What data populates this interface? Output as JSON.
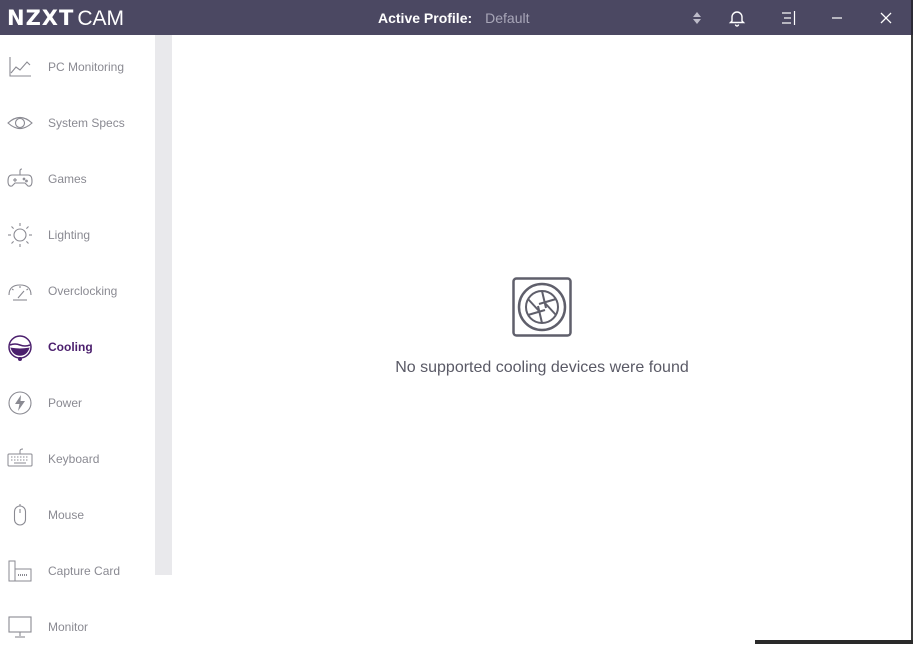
{
  "app": {
    "brand": "NZXT",
    "product": "CAM"
  },
  "header": {
    "profile_label": "Active Profile:",
    "profile_value": "Default",
    "icons": [
      "sort-updown-icon",
      "bell-icon",
      "menu-icon",
      "minimize-icon",
      "close-icon"
    ]
  },
  "sidebar": {
    "items": [
      {
        "label": "PC Monitoring",
        "icon": "line-chart-icon",
        "active": false
      },
      {
        "label": "System Specs",
        "icon": "eye-icon",
        "active": false
      },
      {
        "label": "Games",
        "icon": "gamepad-icon",
        "active": false
      },
      {
        "label": "Lighting",
        "icon": "sun-icon",
        "active": false
      },
      {
        "label": "Overclocking",
        "icon": "gauge-icon",
        "active": false
      },
      {
        "label": "Cooling",
        "icon": "cooling-icon",
        "active": true
      },
      {
        "label": "Power",
        "icon": "lightning-icon",
        "active": false
      },
      {
        "label": "Keyboard",
        "icon": "keyboard-icon",
        "active": false
      },
      {
        "label": "Mouse",
        "icon": "mouse-icon",
        "active": false
      },
      {
        "label": "Capture Card",
        "icon": "capture-card-icon",
        "active": false
      },
      {
        "label": "Monitor",
        "icon": "monitor-icon",
        "active": false
      }
    ]
  },
  "main": {
    "empty_message": "No supported cooling devices were found",
    "empty_icon": "fan-icon"
  },
  "colors": {
    "titlebar": "#4b4862",
    "active": "#4b1f6d",
    "inactive_text": "#8a8a92",
    "icon_stroke": "#5f5f6b"
  }
}
